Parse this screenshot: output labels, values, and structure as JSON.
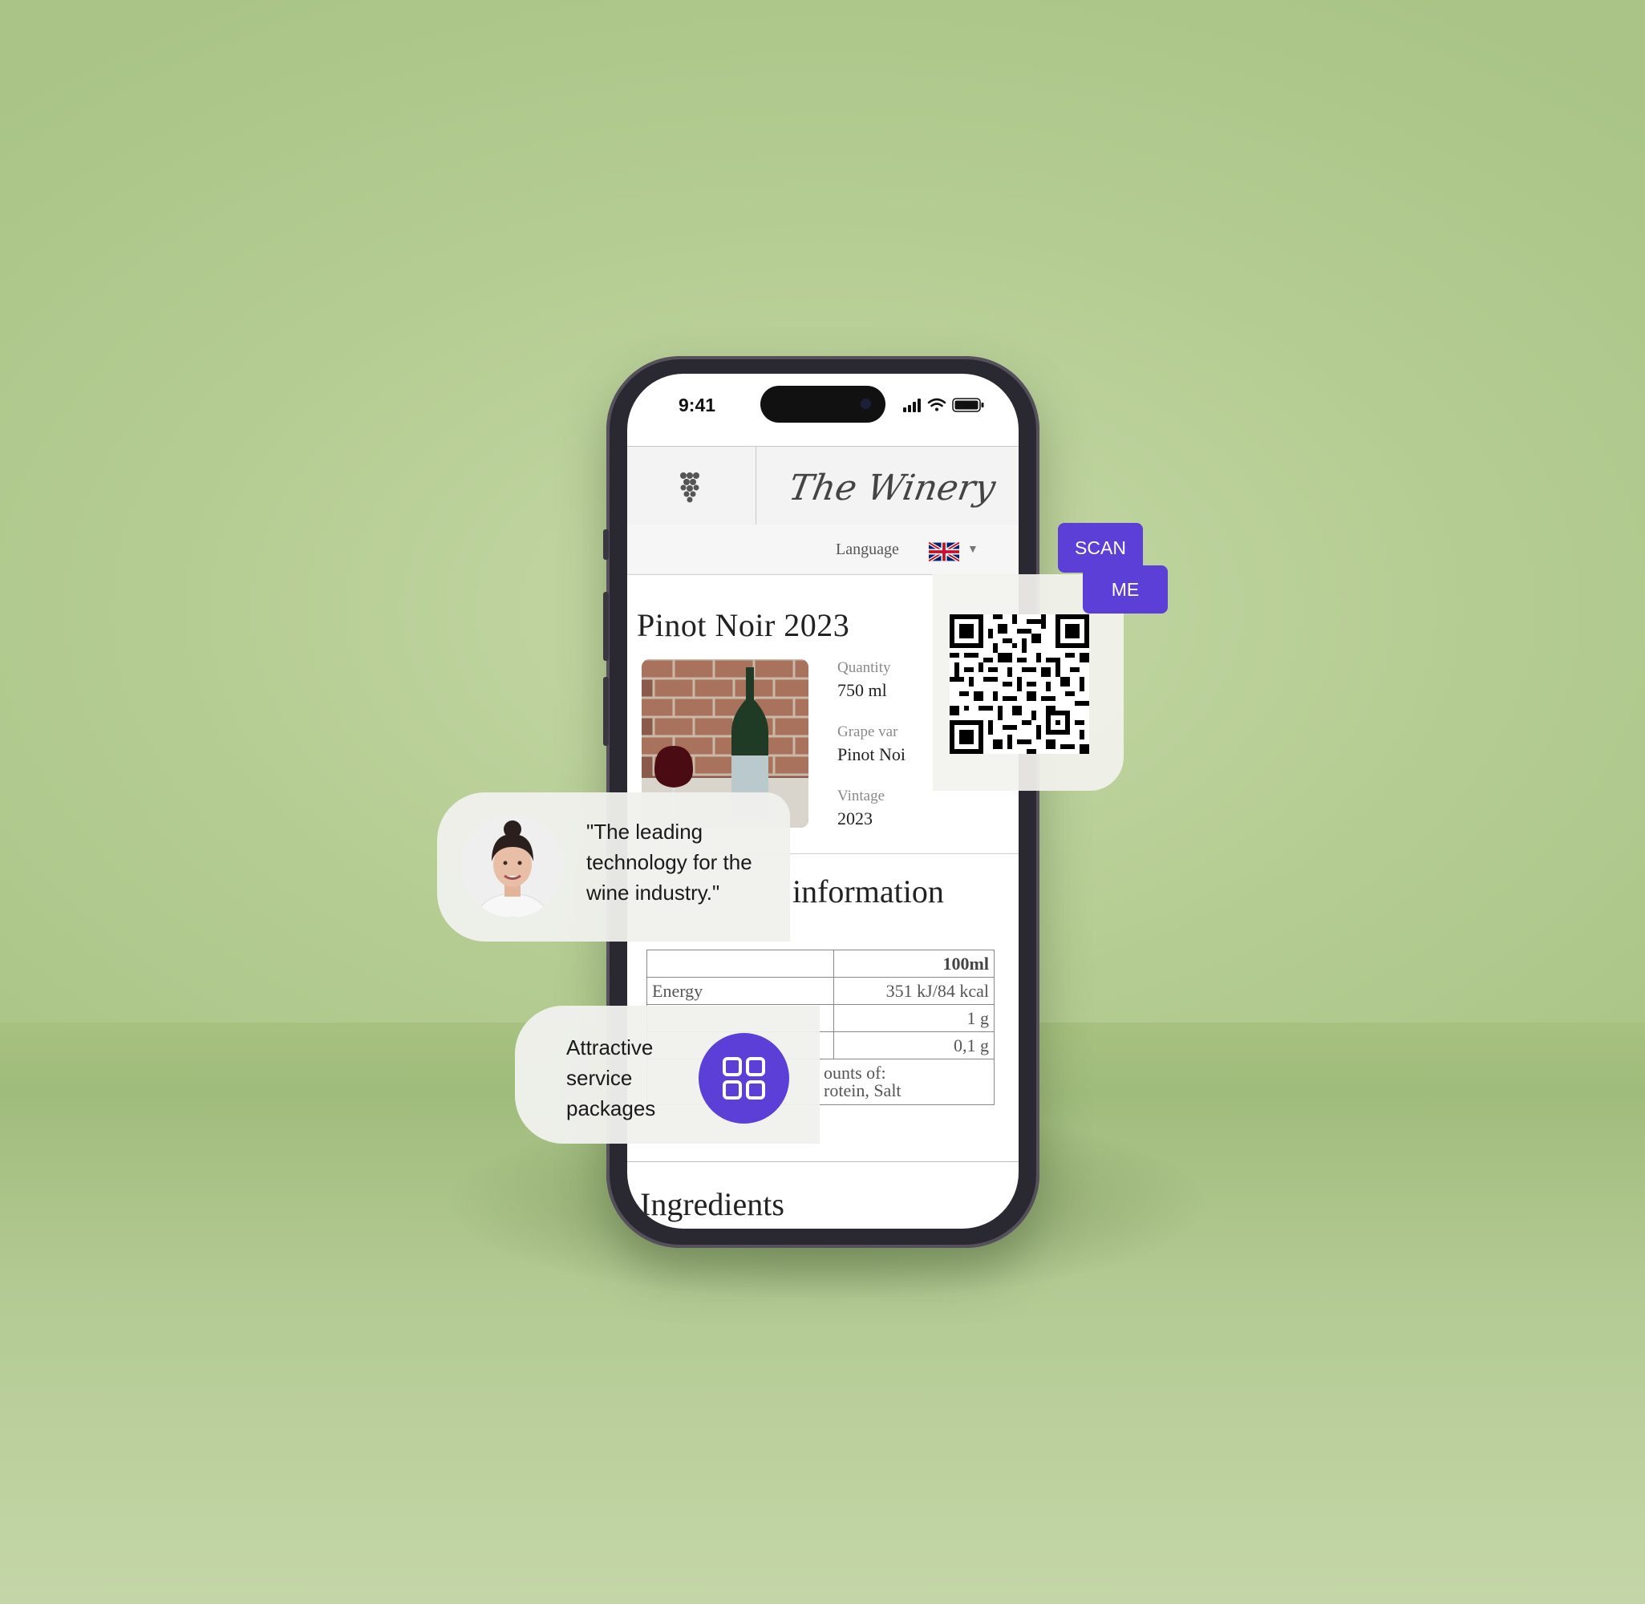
{
  "status_bar": {
    "time": "9:41"
  },
  "header": {
    "brand": "The Winery",
    "language_label": "Language",
    "language_flag": "uk-flag-icon"
  },
  "wine": {
    "title": "Pinot Noir 2023",
    "quantity_label": "Quantity",
    "quantity_value": "750 ml",
    "grape_label": "Grape var",
    "grape_value": "Pinot Noi",
    "vintage_label": "Vintage",
    "vintage_value": "2023"
  },
  "nutrition": {
    "heading": "information",
    "header_col": "100ml",
    "rows": [
      {
        "label": "Energy",
        "value": "351 kJ/84 kcal"
      },
      {
        "label": "",
        "value": "1 g"
      },
      {
        "label": "",
        "value": "0,1 g"
      }
    ],
    "note_line1": "ounts of:",
    "note_line2": "rotein, Salt"
  },
  "ingredients_heading": "Ingredients",
  "scan": {
    "line1": "SCAN",
    "line2": "ME"
  },
  "testimonial": {
    "quote": "\"The leading technology for the wine industry.\""
  },
  "service": {
    "text": "Attractive service packages",
    "icon": "grid-icon"
  },
  "colors": {
    "accent": "#5b3fd6",
    "background": "#b4cc92"
  }
}
